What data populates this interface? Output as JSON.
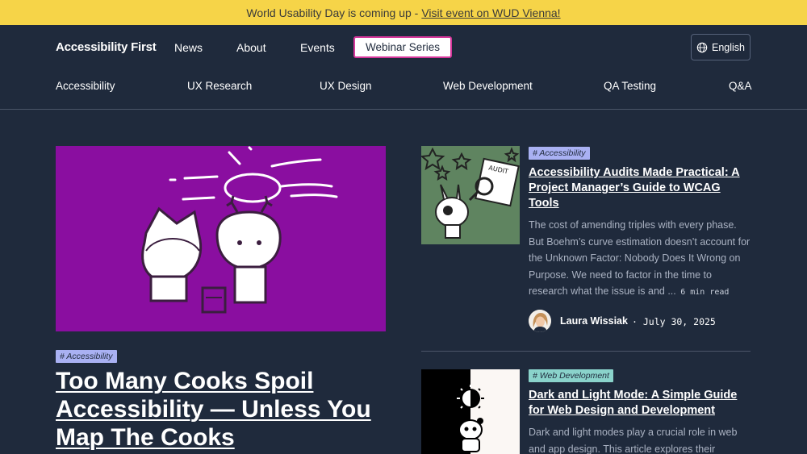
{
  "banner": {
    "text": "World Usability Day is coming up - ",
    "link": "Visit event on WUD Vienna!"
  },
  "header": {
    "brand": "Accessibility First",
    "nav": [
      "News",
      "About",
      "Events"
    ],
    "webinar": "Webinar Series",
    "language": "English"
  },
  "categories": [
    "Accessibility",
    "UX Research",
    "UX Design",
    "Web Development",
    "QA Testing",
    "Q&A"
  ],
  "hero": {
    "tag": "# Accessibility",
    "title": "Too Many Cooks Spoil Accessibility — Unless You Map The Cooks"
  },
  "articles": [
    {
      "tag": "# Accessibility",
      "title": "Accessibility Audits Made Practical: A Project Manager’s Guide to WCAG Tools",
      "excerpt": "The cost of amending triples with every phase. But Boehm’s curve estimation doesn’t account for the Unknown Factor: Nobody Does It Wrong on Purpose. We need to factor in the time to research what the issue is and ...",
      "read_time": "6 min read",
      "author": "Laura Wissiak",
      "date": "· July 30, 2025",
      "image_text": "AUDIT"
    },
    {
      "tag": "# Web Development",
      "title": "Dark and Light Mode: A Simple Guide for Web Design and Development",
      "excerpt": "Dark and light modes play a crucial role in web and app design. This article explores their"
    }
  ],
  "colors": {
    "background": "#1f2a3c",
    "banner": "#f6d448",
    "accent_pink": "#d6379b",
    "hero_image": "#8a0ea0",
    "tag_accessibility": "#a9b1f3",
    "tag_web_development": "#8ad3cb",
    "card_image_green": "#5f8460"
  },
  "icons": [
    "globe-icon"
  ]
}
